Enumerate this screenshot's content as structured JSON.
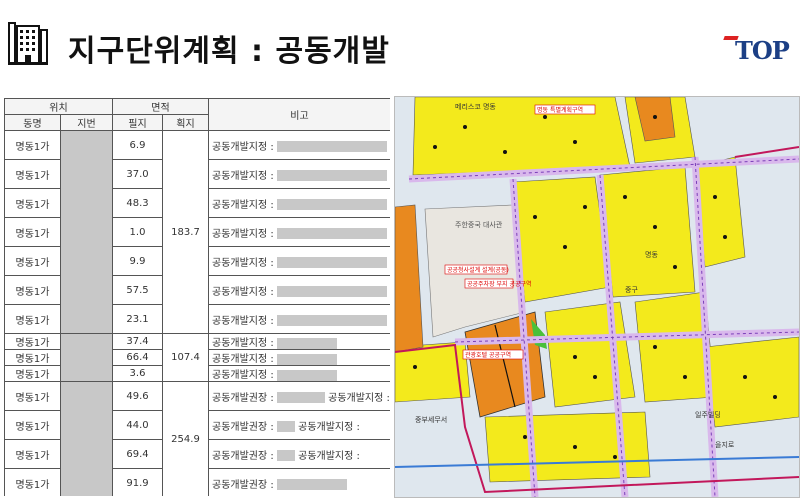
{
  "header": {
    "title": "지구단위계획 : 공동개발",
    "logo_text": "TOP"
  },
  "table": {
    "headers": {
      "location": "위치",
      "area": "면적",
      "remarks": "비고",
      "dong": "동명",
      "jibun": "지번",
      "parcel_area": "필지",
      "block_area": "획지"
    },
    "rows": [
      {
        "dong": "명동1가",
        "parcel": "6.9",
        "note": "공동개발지정 :"
      },
      {
        "dong": "명동1가",
        "parcel": "37.0",
        "note": "공동개발지정 :"
      },
      {
        "dong": "명동1가",
        "parcel": "48.3",
        "note": "공동개발지정 :"
      },
      {
        "dong": "명동1가",
        "parcel": "1.0",
        "note": "공동개발지정 :"
      },
      {
        "dong": "명동1가",
        "parcel": "9.9",
        "note": "공동개발지정 :"
      },
      {
        "dong": "명동1가",
        "parcel": "57.5",
        "note": "공동개발지정 :"
      },
      {
        "dong": "명동1가",
        "parcel": "23.1",
        "note": "공동개발지정 :"
      },
      {
        "dong": "명동1가",
        "parcel": "37.4",
        "note": "공동개발지정 :"
      },
      {
        "dong": "명동1가",
        "parcel": "66.4",
        "note": "공동개발지정 :"
      },
      {
        "dong": "명동1가",
        "parcel": "3.6",
        "note": "공동개발지정 :"
      },
      {
        "dong": "명동1가",
        "parcel": "49.6",
        "note": "공동개발권장 :",
        "note_b": "공동개발지정 :"
      },
      {
        "dong": "명동1가",
        "parcel": "44.0",
        "note": "공동개발권장 :",
        "note_b": "공동개발지정 :"
      },
      {
        "dong": "명동1가",
        "parcel": "69.4",
        "note": "공동개발권장 :",
        "note_b": "공동개발지정 :"
      },
      {
        "dong": "명동1가",
        "parcel": "91.9",
        "note": "공동개발권장 :"
      }
    ],
    "block_totals": [
      "183.7",
      "107.4",
      "254.9"
    ]
  },
  "map": {
    "labels": {
      "embassy": "주한중국 대사관",
      "lotte": "메리스코 명동",
      "ilju": "일주빌딩",
      "myeongdong": "명동",
      "junggu": "중구",
      "eulji": "을지로",
      "seoul": "중부세무서",
      "red1": "공공청사설계 설계(공동)",
      "red2": "공공주차장 부지 공공구역",
      "red3": "명동 특별계획구역",
      "red4": "관광호텔 공공구역"
    },
    "colors": {
      "block": "#f3ea1c",
      "orange": "#e8891f",
      "road": "#d9b8ec",
      "zone_line": "#c2185b",
      "green": "#4ac03a"
    }
  }
}
